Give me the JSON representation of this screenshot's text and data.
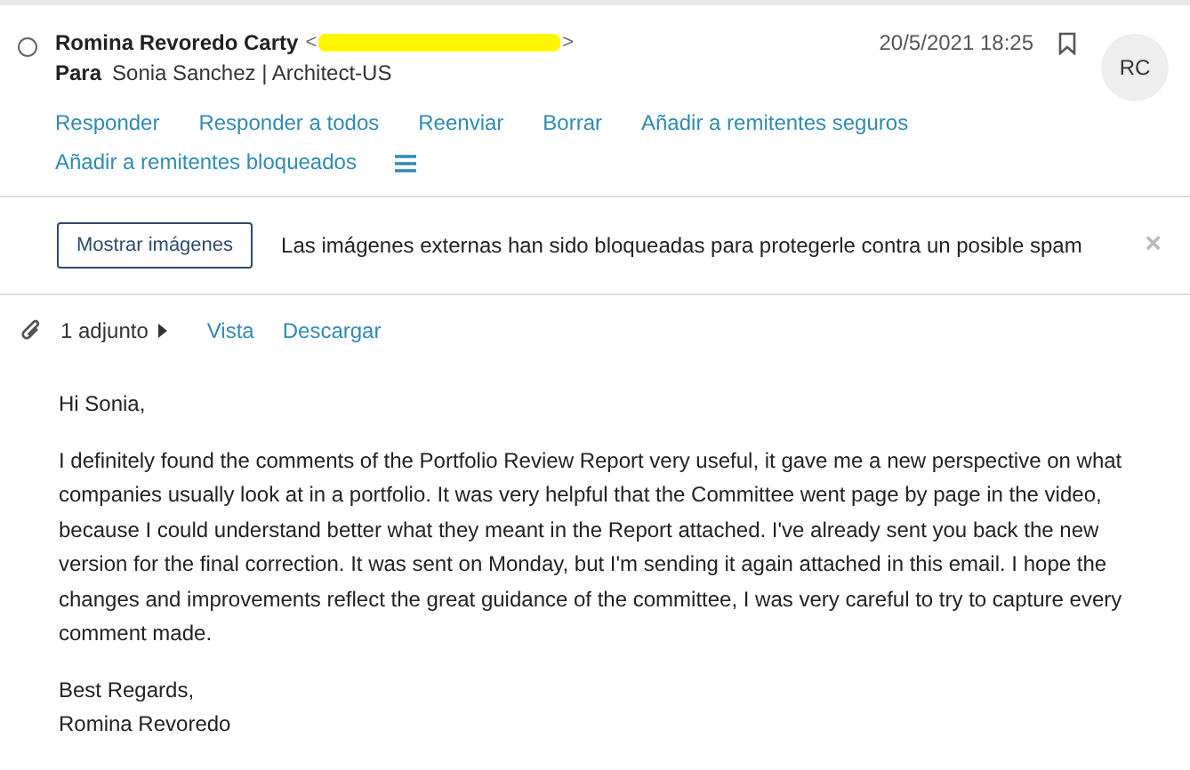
{
  "message": {
    "selected": false,
    "sender": "Romina Revoredo Carty",
    "address_open": "<",
    "address_close": ">",
    "address_redacted": true,
    "date": "20/5/2021 18:25",
    "flagged": false,
    "to_label": "Para",
    "recipient": "Sonia Sanchez | Architect-US",
    "avatar": "RC"
  },
  "actions": [
    "Responder",
    "Responder a todos",
    "Reenviar",
    "Borrar",
    "Añadir a remitentes seguros",
    "Añadir a remitentes bloqueados"
  ],
  "notice": {
    "button": "Mostrar imágenes",
    "text": "Las imágenes externas han sido bloqueadas para protegerle contra un posible spam",
    "close": "×"
  },
  "attachments": {
    "count": "1 adjunto",
    "links": [
      "Vista",
      "Descargar"
    ]
  },
  "body": [
    "Hi Sonia,",
    "I definitely found the comments of the Portfolio Review Report very useful, it gave me a new perspective on what companies usually look at in a portfolio. It was very helpful that the Committee went page by page in the video, because I could understand better what they meant in the Report attached. I've already sent you back the new version for the final correction. It was sent on Monday, but I'm sending it again attached in this email. I hope the changes and improvements reflect the great guidance of the committee, I was very careful to try to capture every comment made.",
    "Best Regards,\nRomina Revoredo"
  ]
}
